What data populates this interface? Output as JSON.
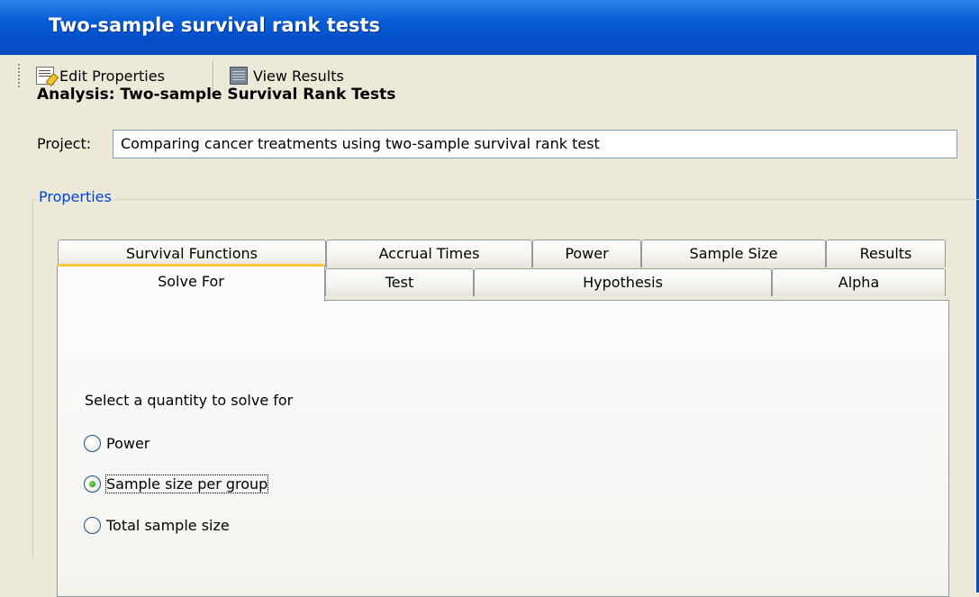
{
  "window": {
    "title": "Two-sample survival rank tests"
  },
  "toolbar": {
    "edit_properties_label": "Edit Properties",
    "edit_properties_icon": "edit-properties-icon",
    "view_results_label": "View Results",
    "view_results_icon": "view-results-icon"
  },
  "analysis": {
    "heading": "Analysis: Two-sample Survival Rank Tests",
    "project_label": "Project:",
    "project_value": "Comparing cancer treatments using two-sample survival rank test"
  },
  "properties": {
    "legend": "Properties",
    "tabs_row1": [
      "Survival Functions",
      "Accrual Times",
      "Power",
      "Sample Size",
      "Results"
    ],
    "tabs_row2": [
      "Solve For",
      "Test",
      "Hypothesis",
      "Alpha"
    ],
    "selected_tab": "Solve For"
  },
  "solve_for": {
    "prompt": "Select a quantity to solve for",
    "options": [
      "Power",
      "Sample size per group",
      "Total sample size"
    ],
    "selected": "Sample size per group"
  },
  "colors": {
    "title_bar": "#0a5fd8",
    "legend_text": "#0046d5",
    "selected_tab_accent": "#ffc83c",
    "radio_selected": "#21a121"
  }
}
